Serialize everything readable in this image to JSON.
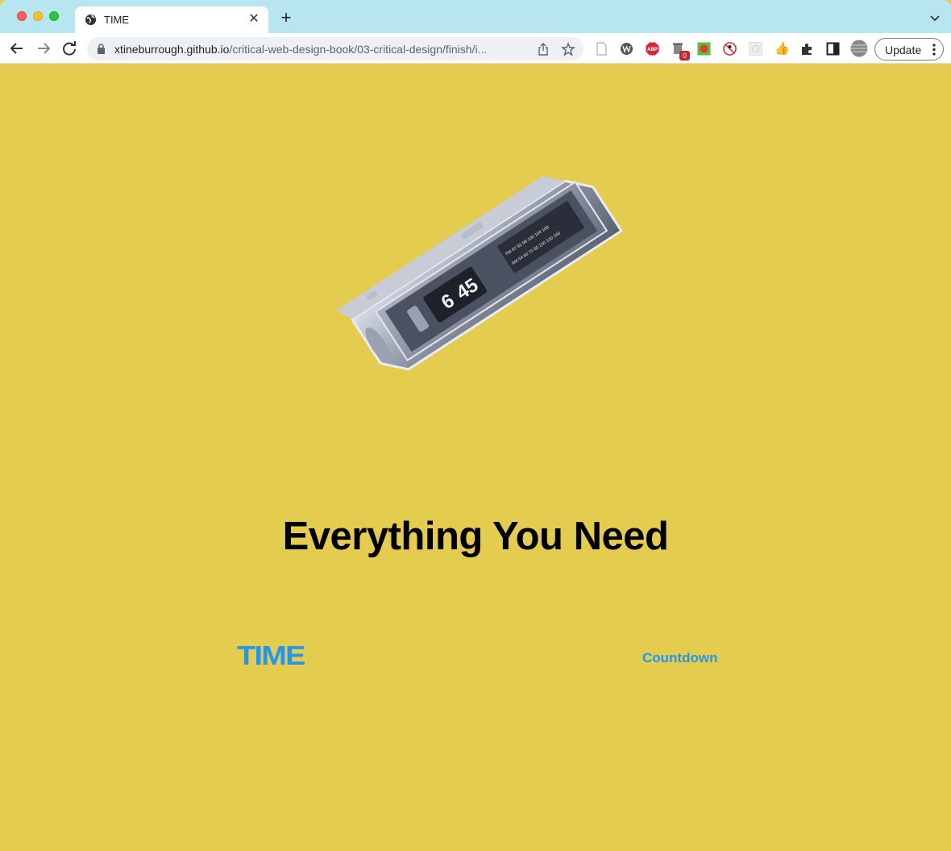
{
  "browser": {
    "tab_title": "TIME",
    "url_host": "xtineburrough.github.io",
    "url_path": "/critical-web-design-book/03-critical-design/finish/i...",
    "update_label": "Update",
    "extension_badge": "0",
    "extension_abp_label": "ABP"
  },
  "page": {
    "headline": "Everything You Need",
    "brand": "TIME",
    "nav_link": "Countdown",
    "clock": {
      "hour": "6",
      "minute": "45",
      "fm_scale": "FM 87 92 98 100 104 108",
      "am_scale": "AM 54 60 70 80 100 130 160"
    }
  },
  "colors": {
    "background": "#e4cc4f",
    "accent": "#2196f3",
    "tabstrip": "#b8e6f0"
  }
}
